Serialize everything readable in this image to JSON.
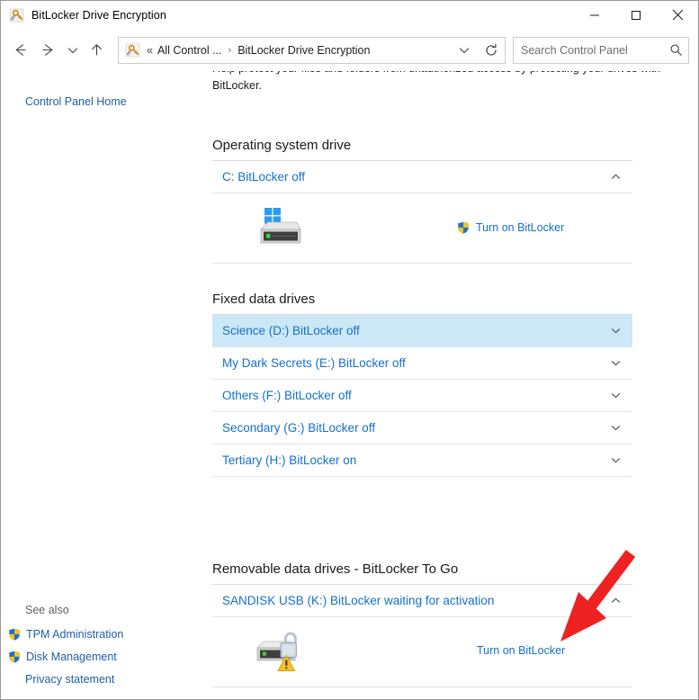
{
  "window": {
    "title": "BitLocker Drive Encryption",
    "icon": "bitlocker-key-icon",
    "caption": {
      "minimize": "minimize-button",
      "maximize": "maximize-button",
      "close": "close-button"
    }
  },
  "navbar": {
    "back": "back-button",
    "forward": "forward-button",
    "recent": "recent-locations-button",
    "up": "up-one-level-button",
    "breadcrumb": {
      "icon": "bitlocker-key-icon",
      "overflow": "«",
      "items": [
        "All Control ...",
        "BitLocker Drive Encryption"
      ],
      "separator": "›"
    },
    "dropdown": "address-dropdown-button",
    "refresh": "refresh-button",
    "search": {
      "placeholder": "Search Control Panel",
      "value": ""
    }
  },
  "sidebar": {
    "control_panel_home": "Control Panel Home",
    "see_also": {
      "title": "See also",
      "items": [
        {
          "label": "TPM Administration",
          "icon": "uac-shield-icon"
        },
        {
          "label": "Disk Management",
          "icon": "uac-shield-icon"
        },
        {
          "label": "Privacy statement",
          "icon": null
        }
      ]
    }
  },
  "content": {
    "intro": "Help protect your files and folders from unauthorized access by protecting your drives with BitLocker.",
    "sections": [
      {
        "title": "Operating system drive",
        "drives": [
          {
            "label": "C: BitLocker off",
            "expanded": true,
            "chevron": "chevron-up-icon",
            "highlight": false,
            "icon": "windows-hard-drive-icon",
            "action": {
              "label": "Turn on BitLocker",
              "shield": true
            }
          }
        ]
      },
      {
        "title": "Fixed data drives",
        "drives": [
          {
            "label": "Science (D:) BitLocker off",
            "expanded": false,
            "chevron": "chevron-down-icon",
            "highlight": true
          },
          {
            "label": "My Dark Secrets (E:) BitLocker off",
            "expanded": false,
            "chevron": "chevron-down-icon",
            "highlight": false
          },
          {
            "label": "Others (F:) BitLocker off",
            "expanded": false,
            "chevron": "chevron-down-icon",
            "highlight": false
          },
          {
            "label": "Secondary (G:) BitLocker off",
            "expanded": false,
            "chevron": "chevron-down-icon",
            "highlight": false
          },
          {
            "label": "Tertiary (H:) BitLocker on",
            "expanded": false,
            "chevron": "chevron-down-icon",
            "highlight": false
          }
        ]
      },
      {
        "title": "Removable data drives - BitLocker To Go",
        "drives": [
          {
            "label": "SANDISK USB (K:) BitLocker waiting for activation",
            "expanded": true,
            "chevron": "chevron-up-icon",
            "highlight": false,
            "icon": "usb-drive-unlocked-warning-icon",
            "action": {
              "label": "Turn on BitLocker",
              "shield": false
            }
          }
        ]
      }
    ]
  },
  "annotation": {
    "type": "red-arrow",
    "color": "#ee2222",
    "points_to": "Turn on BitLocker"
  },
  "colors": {
    "link": "#1470cc",
    "sidebar_link": "#1e5fa8",
    "highlight_row": "#cce8f7",
    "text": "#1a1a1a",
    "divider": "#e4e4e4",
    "arrow_red": "#ee2222"
  }
}
